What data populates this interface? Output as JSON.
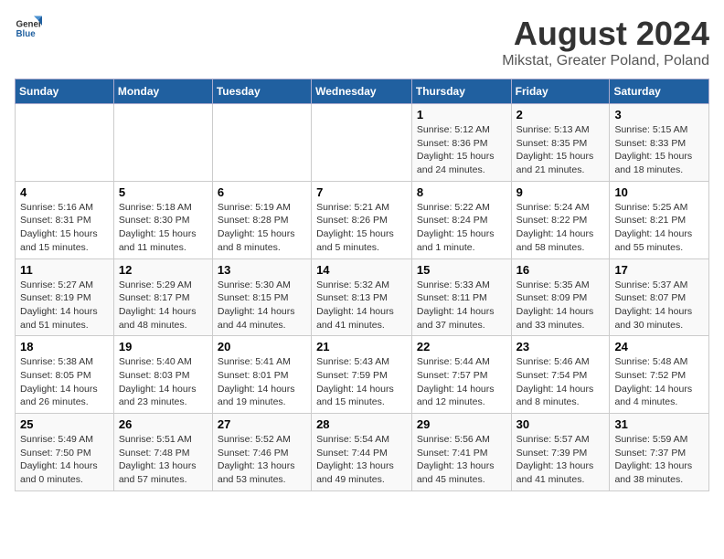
{
  "logo": {
    "text_general": "General",
    "text_blue": "Blue"
  },
  "title": "August 2024",
  "subtitle": "Mikstat, Greater Poland, Poland",
  "days_of_week": [
    "Sunday",
    "Monday",
    "Tuesday",
    "Wednesday",
    "Thursday",
    "Friday",
    "Saturday"
  ],
  "weeks": [
    [
      {
        "day": "",
        "info": ""
      },
      {
        "day": "",
        "info": ""
      },
      {
        "day": "",
        "info": ""
      },
      {
        "day": "",
        "info": ""
      },
      {
        "day": "1",
        "info": "Sunrise: 5:12 AM\nSunset: 8:36 PM\nDaylight: 15 hours and 24 minutes."
      },
      {
        "day": "2",
        "info": "Sunrise: 5:13 AM\nSunset: 8:35 PM\nDaylight: 15 hours and 21 minutes."
      },
      {
        "day": "3",
        "info": "Sunrise: 5:15 AM\nSunset: 8:33 PM\nDaylight: 15 hours and 18 minutes."
      }
    ],
    [
      {
        "day": "4",
        "info": "Sunrise: 5:16 AM\nSunset: 8:31 PM\nDaylight: 15 hours and 15 minutes."
      },
      {
        "day": "5",
        "info": "Sunrise: 5:18 AM\nSunset: 8:30 PM\nDaylight: 15 hours and 11 minutes."
      },
      {
        "day": "6",
        "info": "Sunrise: 5:19 AM\nSunset: 8:28 PM\nDaylight: 15 hours and 8 minutes."
      },
      {
        "day": "7",
        "info": "Sunrise: 5:21 AM\nSunset: 8:26 PM\nDaylight: 15 hours and 5 minutes."
      },
      {
        "day": "8",
        "info": "Sunrise: 5:22 AM\nSunset: 8:24 PM\nDaylight: 15 hours and 1 minute."
      },
      {
        "day": "9",
        "info": "Sunrise: 5:24 AM\nSunset: 8:22 PM\nDaylight: 14 hours and 58 minutes."
      },
      {
        "day": "10",
        "info": "Sunrise: 5:25 AM\nSunset: 8:21 PM\nDaylight: 14 hours and 55 minutes."
      }
    ],
    [
      {
        "day": "11",
        "info": "Sunrise: 5:27 AM\nSunset: 8:19 PM\nDaylight: 14 hours and 51 minutes."
      },
      {
        "day": "12",
        "info": "Sunrise: 5:29 AM\nSunset: 8:17 PM\nDaylight: 14 hours and 48 minutes."
      },
      {
        "day": "13",
        "info": "Sunrise: 5:30 AM\nSunset: 8:15 PM\nDaylight: 14 hours and 44 minutes."
      },
      {
        "day": "14",
        "info": "Sunrise: 5:32 AM\nSunset: 8:13 PM\nDaylight: 14 hours and 41 minutes."
      },
      {
        "day": "15",
        "info": "Sunrise: 5:33 AM\nSunset: 8:11 PM\nDaylight: 14 hours and 37 minutes."
      },
      {
        "day": "16",
        "info": "Sunrise: 5:35 AM\nSunset: 8:09 PM\nDaylight: 14 hours and 33 minutes."
      },
      {
        "day": "17",
        "info": "Sunrise: 5:37 AM\nSunset: 8:07 PM\nDaylight: 14 hours and 30 minutes."
      }
    ],
    [
      {
        "day": "18",
        "info": "Sunrise: 5:38 AM\nSunset: 8:05 PM\nDaylight: 14 hours and 26 minutes."
      },
      {
        "day": "19",
        "info": "Sunrise: 5:40 AM\nSunset: 8:03 PM\nDaylight: 14 hours and 23 minutes."
      },
      {
        "day": "20",
        "info": "Sunrise: 5:41 AM\nSunset: 8:01 PM\nDaylight: 14 hours and 19 minutes."
      },
      {
        "day": "21",
        "info": "Sunrise: 5:43 AM\nSunset: 7:59 PM\nDaylight: 14 hours and 15 minutes."
      },
      {
        "day": "22",
        "info": "Sunrise: 5:44 AM\nSunset: 7:57 PM\nDaylight: 14 hours and 12 minutes."
      },
      {
        "day": "23",
        "info": "Sunrise: 5:46 AM\nSunset: 7:54 PM\nDaylight: 14 hours and 8 minutes."
      },
      {
        "day": "24",
        "info": "Sunrise: 5:48 AM\nSunset: 7:52 PM\nDaylight: 14 hours and 4 minutes."
      }
    ],
    [
      {
        "day": "25",
        "info": "Sunrise: 5:49 AM\nSunset: 7:50 PM\nDaylight: 14 hours and 0 minutes."
      },
      {
        "day": "26",
        "info": "Sunrise: 5:51 AM\nSunset: 7:48 PM\nDaylight: 13 hours and 57 minutes."
      },
      {
        "day": "27",
        "info": "Sunrise: 5:52 AM\nSunset: 7:46 PM\nDaylight: 13 hours and 53 minutes."
      },
      {
        "day": "28",
        "info": "Sunrise: 5:54 AM\nSunset: 7:44 PM\nDaylight: 13 hours and 49 minutes."
      },
      {
        "day": "29",
        "info": "Sunrise: 5:56 AM\nSunset: 7:41 PM\nDaylight: 13 hours and 45 minutes."
      },
      {
        "day": "30",
        "info": "Sunrise: 5:57 AM\nSunset: 7:39 PM\nDaylight: 13 hours and 41 minutes."
      },
      {
        "day": "31",
        "info": "Sunrise: 5:59 AM\nSunset: 7:37 PM\nDaylight: 13 hours and 38 minutes."
      }
    ]
  ]
}
